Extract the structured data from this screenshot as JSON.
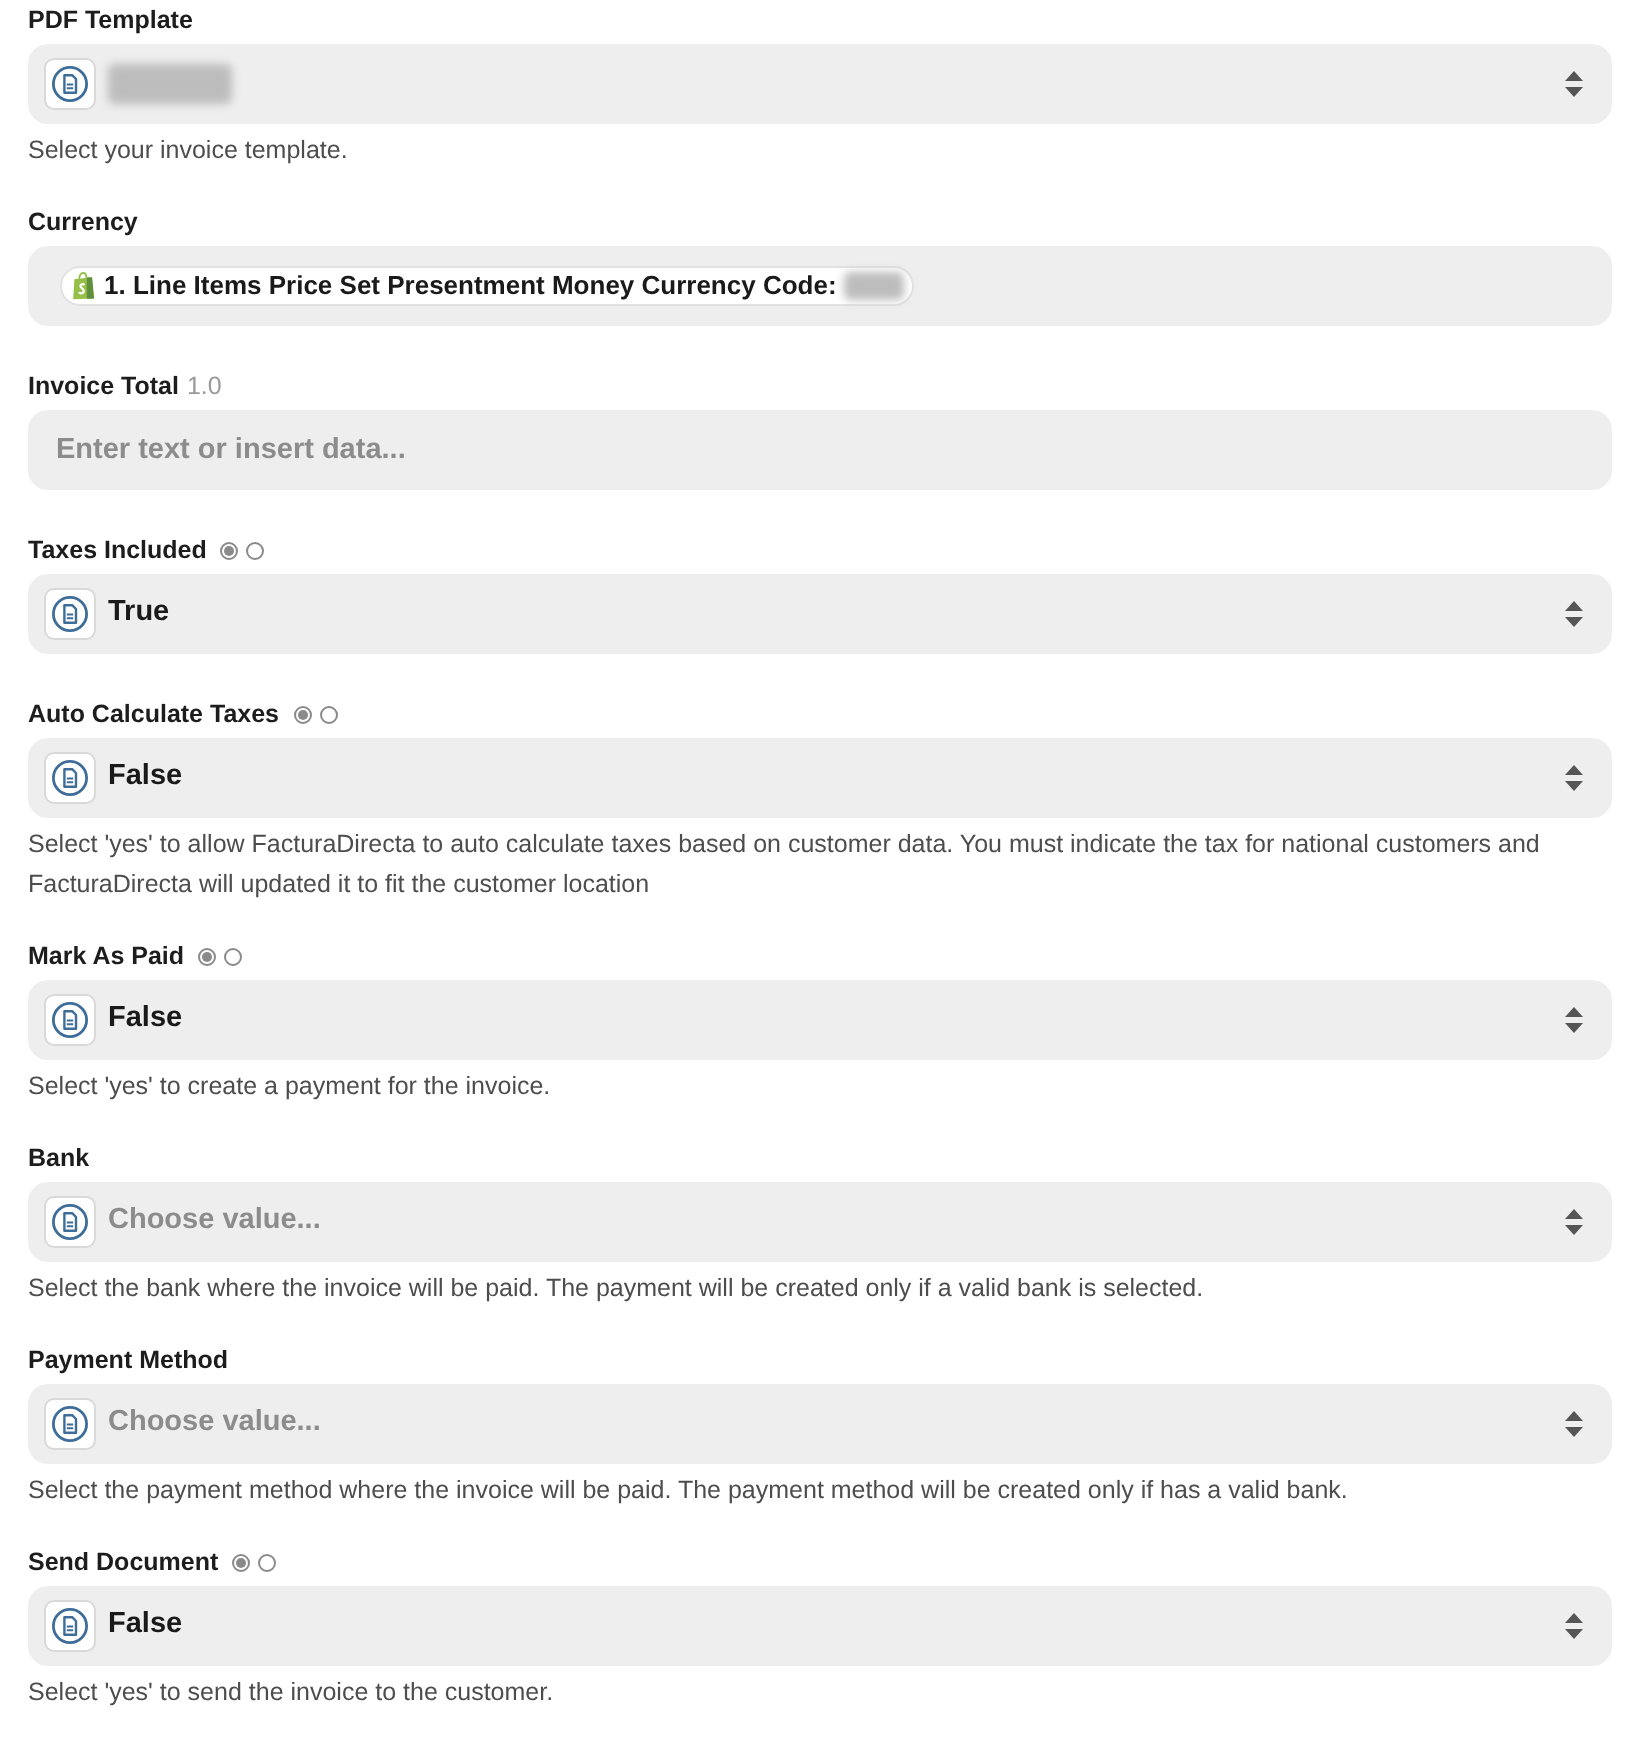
{
  "fields": [
    {
      "label": "PDF Template",
      "kind": "select",
      "redacted": true,
      "help": "Select your invoice template."
    },
    {
      "label": "Currency",
      "kind": "mapped",
      "token": {
        "text": "1. Line Items Price Set Presentment Money Currency Code:",
        "redacted": true
      }
    },
    {
      "label": "Invoice Total",
      "label_note": "1.0",
      "kind": "text",
      "placeholder": "Enter text or insert data..."
    },
    {
      "label": "Taxes Included",
      "toggle": [
        {
          "selected": true
        },
        {
          "selected": false
        }
      ],
      "kind": "select",
      "value": "True"
    },
    {
      "label": "Auto Calculate Taxes",
      "toggle": [
        {
          "selected": true
        },
        {
          "selected": false
        }
      ],
      "kind": "select",
      "value": "False",
      "help": "Select 'yes' to allow FacturaDirecta to auto calculate taxes based on customer data. You must indicate the tax for national customers and FacturaDirecta will updated it to fit the customer location"
    },
    {
      "label": "Mark As Paid",
      "toggle": [
        {
          "selected": true
        },
        {
          "selected": false
        }
      ],
      "kind": "select",
      "value": "False",
      "help": "Select 'yes' to create a payment for the invoice."
    },
    {
      "label": "Bank",
      "kind": "select",
      "placeholder": "Choose value...",
      "help": "Select the bank where the invoice will be paid. The payment will be created only if a valid bank is selected."
    },
    {
      "label": "Payment Method",
      "kind": "select",
      "placeholder": "Choose value...",
      "help": "Select the payment method where the invoice will be paid. The payment method will be created only if has a valid bank."
    },
    {
      "label": "Send Document",
      "toggle": [
        {
          "selected": true
        },
        {
          "selected": false
        }
      ],
      "kind": "select",
      "value": "False",
      "help": "Select 'yes' to send the invoice to the customer."
    }
  ]
}
